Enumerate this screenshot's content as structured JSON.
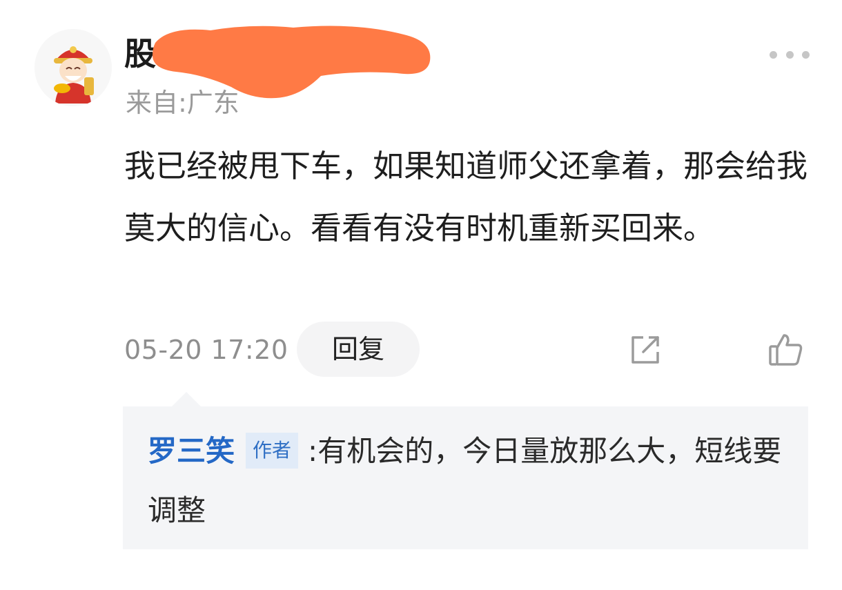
{
  "comment": {
    "username": "股",
    "location": "来自:广东",
    "text": "我已经被甩下车，如果知道师父还拿着，那会给我莫大的信心。看看有没有时机重新买回来。",
    "timestamp": "05-20 17:20",
    "reply_label": "回复",
    "avatar_icon": "fortune-god-avatar",
    "redaction_color": "#ff7a45"
  },
  "actions": {
    "more_icon": "more-dots-icon",
    "share_icon": "share-icon",
    "like_icon": "thumbs-up-icon"
  },
  "reply": {
    "author": "罗三笑",
    "author_badge": "作者",
    "separator": ":",
    "text": "有机会的，今日量放那么大，短线要调整",
    "author_color": "#2468c6"
  }
}
